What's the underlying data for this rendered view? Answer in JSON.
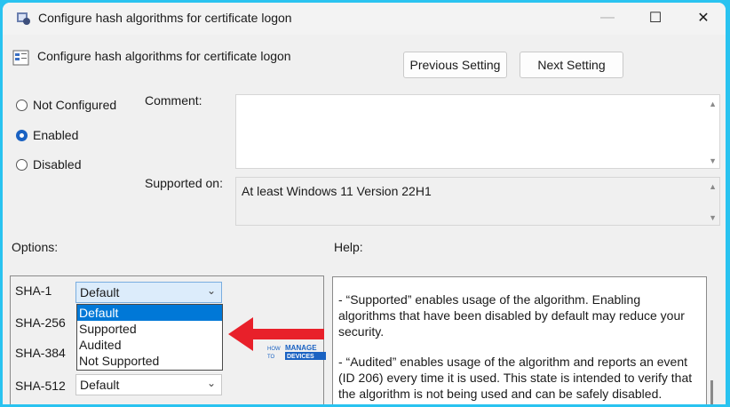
{
  "window": {
    "title": "Configure hash algorithms for certificate logon"
  },
  "header": {
    "title": "Configure hash algorithms for certificate logon"
  },
  "nav": {
    "previous": "Previous Setting",
    "next": "Next Setting"
  },
  "state": {
    "options": [
      "Not Configured",
      "Enabled",
      "Disabled"
    ],
    "selected": "Enabled"
  },
  "labels": {
    "comment": "Comment:",
    "supported_on": "Supported on:",
    "options": "Options:",
    "help": "Help:"
  },
  "supported_on_value": "At least Windows 11 Version 22H1",
  "options_rows": [
    {
      "label": "SHA-1",
      "value": "Default"
    },
    {
      "label": "SHA-256",
      "value": ""
    },
    {
      "label": "SHA-384",
      "value": ""
    },
    {
      "label": "SHA-512",
      "value": "Default"
    }
  ],
  "dropdown_items": [
    "Default",
    "Supported",
    "Audited",
    "Not Supported"
  ],
  "dropdown_selected": "Default",
  "help_paragraphs": [
    "- “Supported” enables usage of the algorithm. Enabling algorithms that have been disabled by default may reduce your security.",
    "- “Audited” enables usage of the algorithm and reports an event (ID 206) every time it is used. This state is intended to verify that the algorithm is not being used and can be safely disabled."
  ],
  "watermark": {
    "line1": "HOW",
    "line2": "TO",
    "brand1": "MANAGE",
    "brand2": "DEVICES"
  },
  "colors": {
    "accent": "#1a62c2",
    "selection": "#0078d7",
    "arrow": "#e8202a",
    "background": "#29c3f0"
  }
}
